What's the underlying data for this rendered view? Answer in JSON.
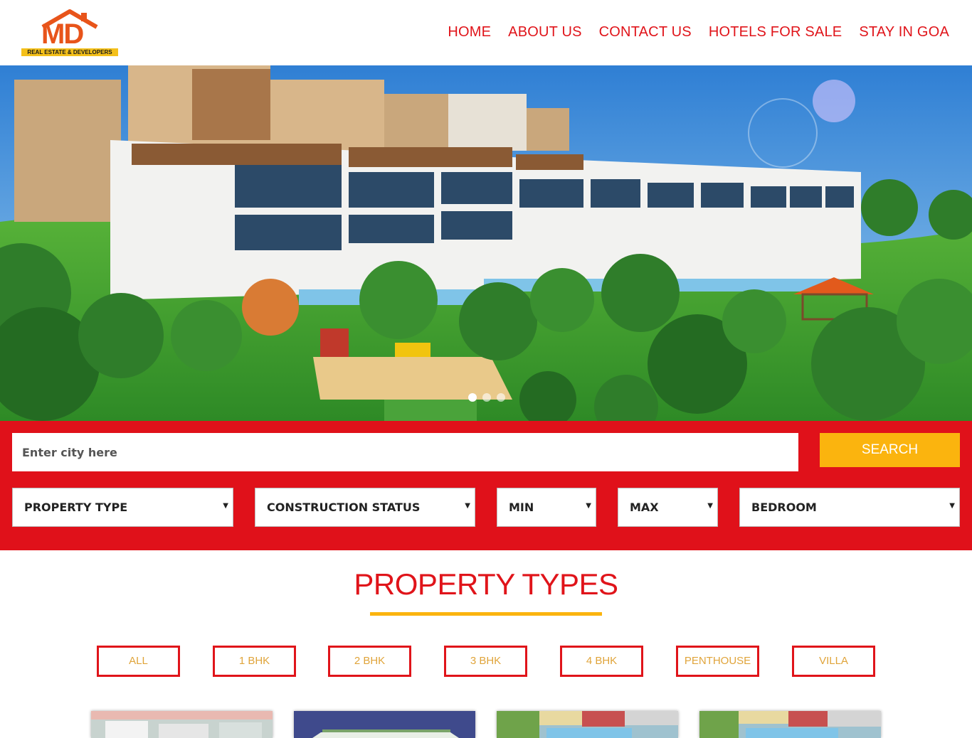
{
  "brand": {
    "logo_text": "MD",
    "tagline": "REAL ESTATE & DEVELOPERS"
  },
  "nav": {
    "items": [
      {
        "label": "HOME"
      },
      {
        "label": "ABOUT US"
      },
      {
        "label": "CONTACT US"
      },
      {
        "label": "HOTELS FOR SALE"
      },
      {
        "label": "STAY IN GOA"
      }
    ]
  },
  "hero": {
    "slide_count": 3,
    "active_slide": 1
  },
  "search": {
    "city_placeholder": "Enter city here",
    "button_label": "SEARCH",
    "filters": {
      "property_type": "PROPERTY TYPE",
      "construction_status": "CONSTRUCTION STATUS",
      "min": "MIN",
      "max": "MAX",
      "bedroom": "BEDROOM"
    }
  },
  "property_types": {
    "title": "PROPERTY TYPES",
    "filters": [
      {
        "label": "ALL"
      },
      {
        "label": "1 BHK"
      },
      {
        "label": "2 BHK"
      },
      {
        "label": "3 BHK"
      },
      {
        "label": "4 BHK"
      },
      {
        "label": "PENTHOUSE"
      },
      {
        "label": "VILLA"
      }
    ]
  },
  "colors": {
    "primary_red": "#e0111a",
    "accent_yellow": "#fbb40e",
    "filter_text": "#e0a43a"
  }
}
